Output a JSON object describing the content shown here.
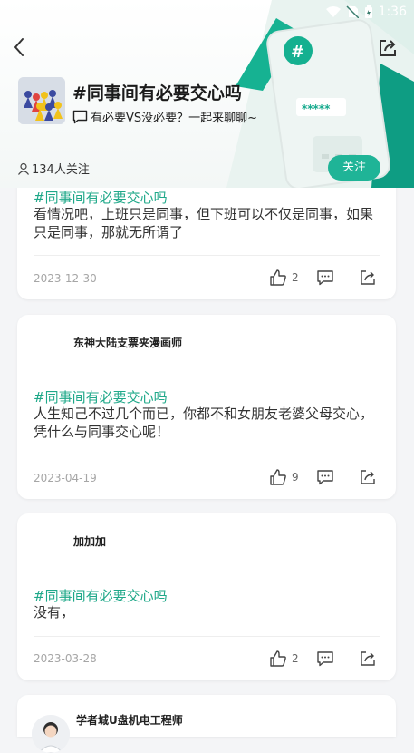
{
  "status_bar": {
    "time": "1:36"
  },
  "topic": {
    "title": "#同事间有必要交心吗",
    "description": "有必要VS没必要？一起来聊聊~",
    "followers": "134人关注",
    "follow_label": "关注"
  },
  "header_art": {
    "stars": "*****"
  },
  "posts": [
    {
      "author": "",
      "tag": "#同事间有必要交心吗",
      "text": "看情况吧，上班只是同事，但下班可以不仅是同事，如果只是同事，那就无所谓了",
      "date": "2023-12-30",
      "likes": "2"
    },
    {
      "author": "东神大陆支票夹漫画师",
      "tag": "#同事间有必要交心吗",
      "text": "人生知己不过几个而已，你都不和女朋友老婆父母交心，凭什么与同事交心呢！",
      "date": "2023-04-19",
      "likes": "9"
    },
    {
      "author": "加加加",
      "tag": "#同事间有必要交心吗",
      "text": "没有，",
      "date": "2023-03-28",
      "likes": "2"
    },
    {
      "author": "学者城U盘机电工程师"
    }
  ],
  "colors": {
    "accent": "#1fb497",
    "tag": "#1fa889",
    "date": "#a6a6a6"
  }
}
